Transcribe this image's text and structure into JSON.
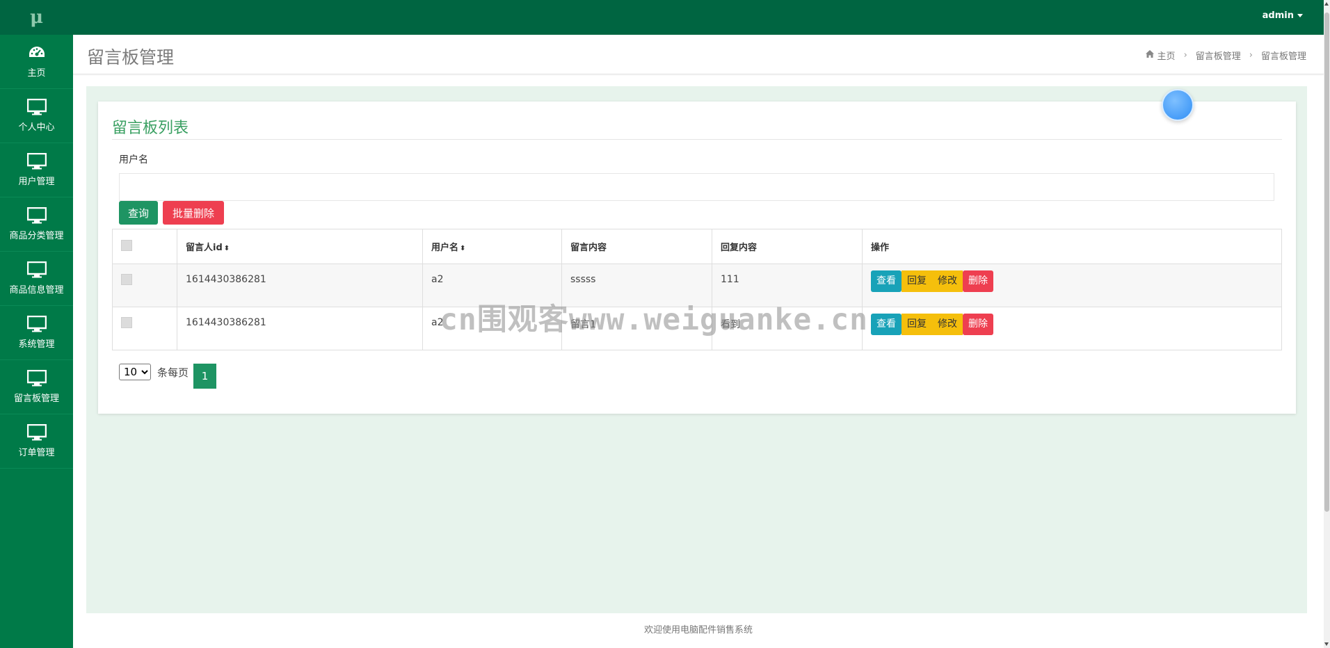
{
  "app": {
    "logo": "μ"
  },
  "topbar": {
    "user_name": "admin"
  },
  "sidebar": {
    "items": [
      {
        "label": "主页",
        "icon": "dashboard-icon"
      },
      {
        "label": "个人中心",
        "icon": "monitor-icon"
      },
      {
        "label": "用户管理",
        "icon": "monitor-icon"
      },
      {
        "label": "商品分类管理",
        "icon": "monitor-icon"
      },
      {
        "label": "商品信息管理",
        "icon": "monitor-icon"
      },
      {
        "label": "系统管理",
        "icon": "monitor-icon"
      },
      {
        "label": "留言板管理",
        "icon": "monitor-icon"
      },
      {
        "label": "订单管理",
        "icon": "monitor-icon"
      }
    ]
  },
  "header": {
    "title": "留言板管理",
    "breadcrumb": [
      "主页",
      "留言板管理",
      "留言板管理"
    ]
  },
  "card": {
    "title": "留言板列表",
    "search_label": "用户名",
    "search_value": "",
    "search_button": "查询",
    "batch_delete_button": "批量删除"
  },
  "table": {
    "columns": [
      "留言人id",
      "用户名",
      "留言内容",
      "回复内容",
      "操作"
    ],
    "rows": [
      {
        "id": "1614430386281",
        "username": "a2",
        "content": "sssss",
        "reply": "111"
      },
      {
        "id": "1614430386281",
        "username": "a2",
        "content": "留言1",
        "reply": "看到"
      }
    ],
    "actions": {
      "view": "查看",
      "reply": "回复",
      "edit": "修改",
      "delete": "删除"
    }
  },
  "pagination": {
    "page_size": "10",
    "page_size_options": [
      "10"
    ],
    "page_size_label": "条每页",
    "current_page": "1"
  },
  "watermark": "cn围观客www.weiguanke.cn",
  "footer": {
    "text": "欢迎使用电脑配件销售系统"
  },
  "colors": {
    "sidebar": "#007a48",
    "topbar": "#006541",
    "accent": "#1e9463",
    "danger": "#ee3f50",
    "warning": "#f5bf0c",
    "info": "#18a2b8",
    "content_bg": "#e7f3ec"
  }
}
